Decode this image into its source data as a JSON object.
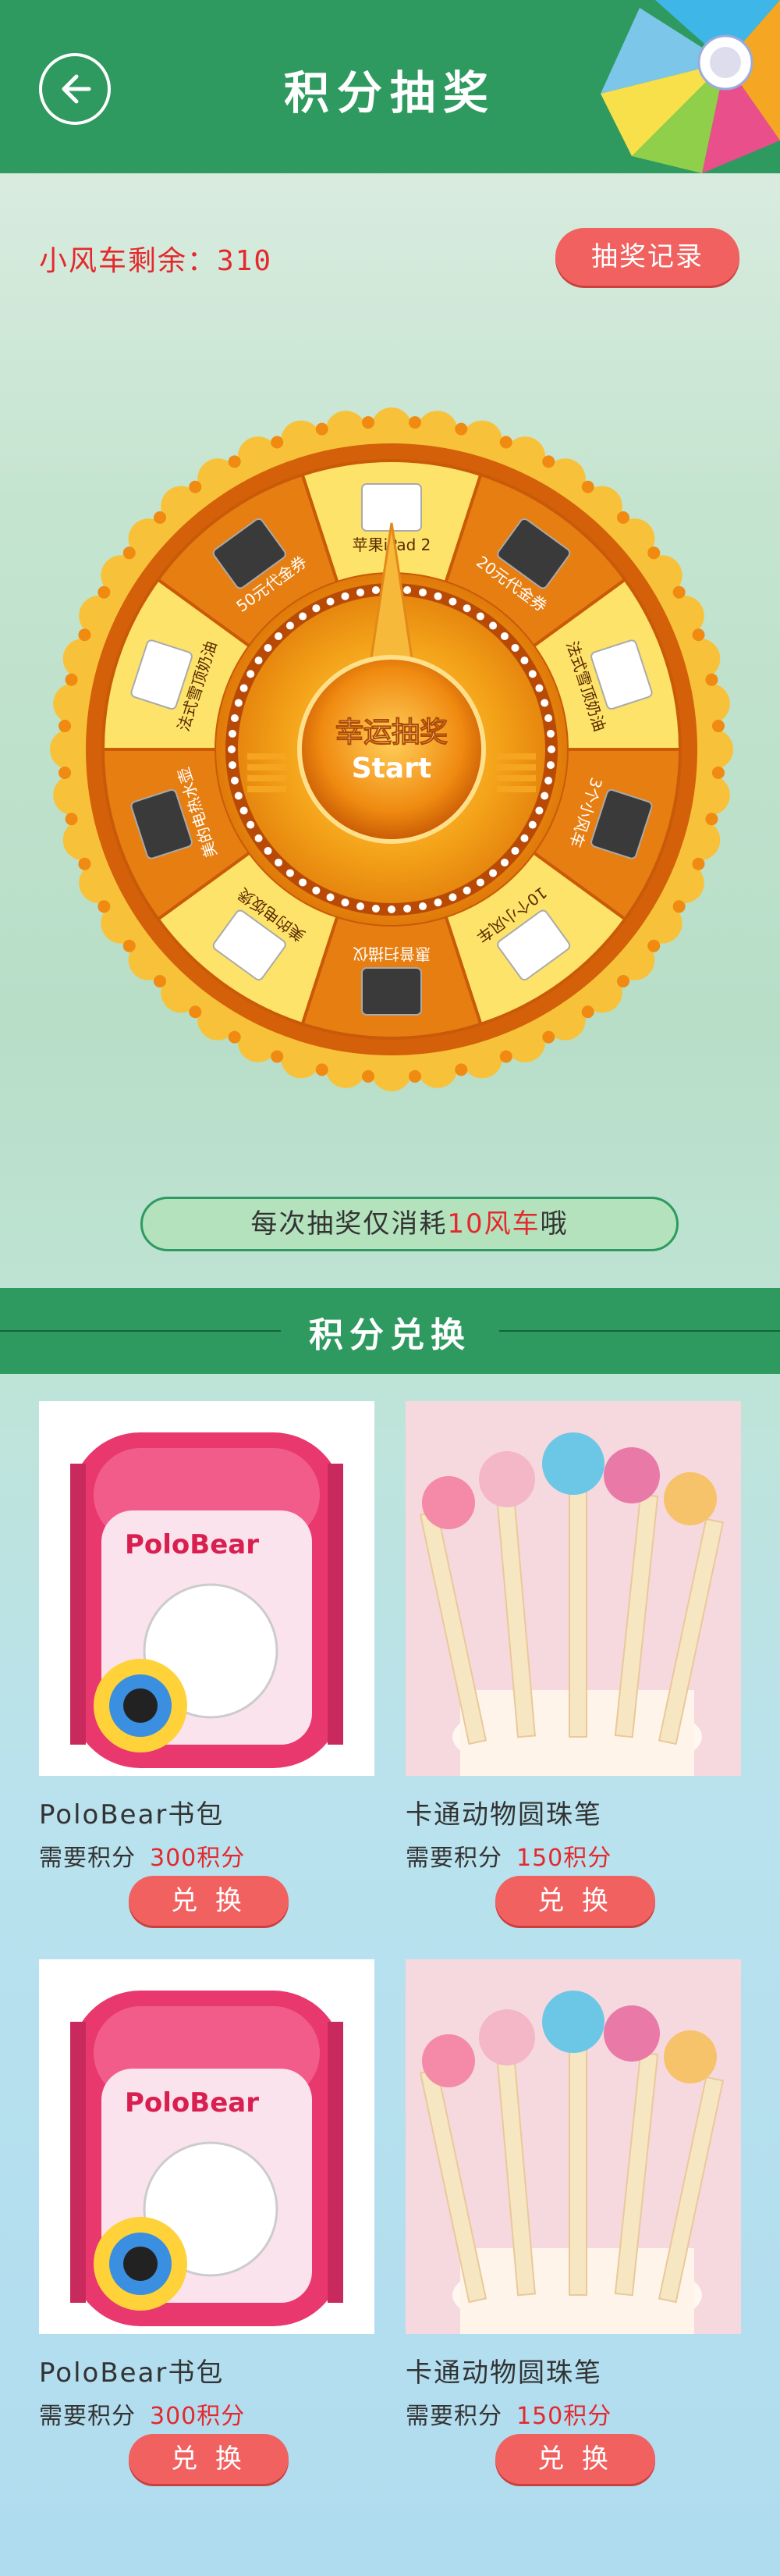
{
  "header": {
    "title": "积分抽奖",
    "back_icon": "arrow-left-icon"
  },
  "summary": {
    "remaining_text": "小风车剩余：310",
    "record_button": "抽奖记录"
  },
  "wheel": {
    "center_title": "幸运抽奖",
    "center_sub": "Start",
    "prizes": [
      "苹果iPad 2",
      "20元代金券",
      "法式雪顶奶油",
      "3个小风车",
      "10个小风车",
      "惠普扫描仪",
      "美的电饭煲",
      "美的电热水壶",
      "法式雪顶奶油",
      "50元代金券"
    ]
  },
  "tip": {
    "prefix": "每次抽奖仅消耗",
    "highlight": "10风车",
    "suffix": "哦"
  },
  "exchange": {
    "title": "积分兑换",
    "items": [
      {
        "name": "PoloBear书包",
        "points_label": "需要积分",
        "points": "300积分",
        "button": "兑 换"
      },
      {
        "name": "卡通动物圆珠笔",
        "points_label": "需要积分",
        "points": "150积分",
        "button": "兑 换"
      },
      {
        "name": "PoloBear书包",
        "points_label": "需要积分",
        "points": "300积分",
        "button": "兑 换"
      },
      {
        "name": "卡通动物圆珠笔",
        "points_label": "需要积分",
        "points": "150积分",
        "button": "兑 换"
      }
    ]
  },
  "colors": {
    "primary_green": "#2e9a5f",
    "accent_red": "#e5282c",
    "button_red": "#f0615f"
  }
}
